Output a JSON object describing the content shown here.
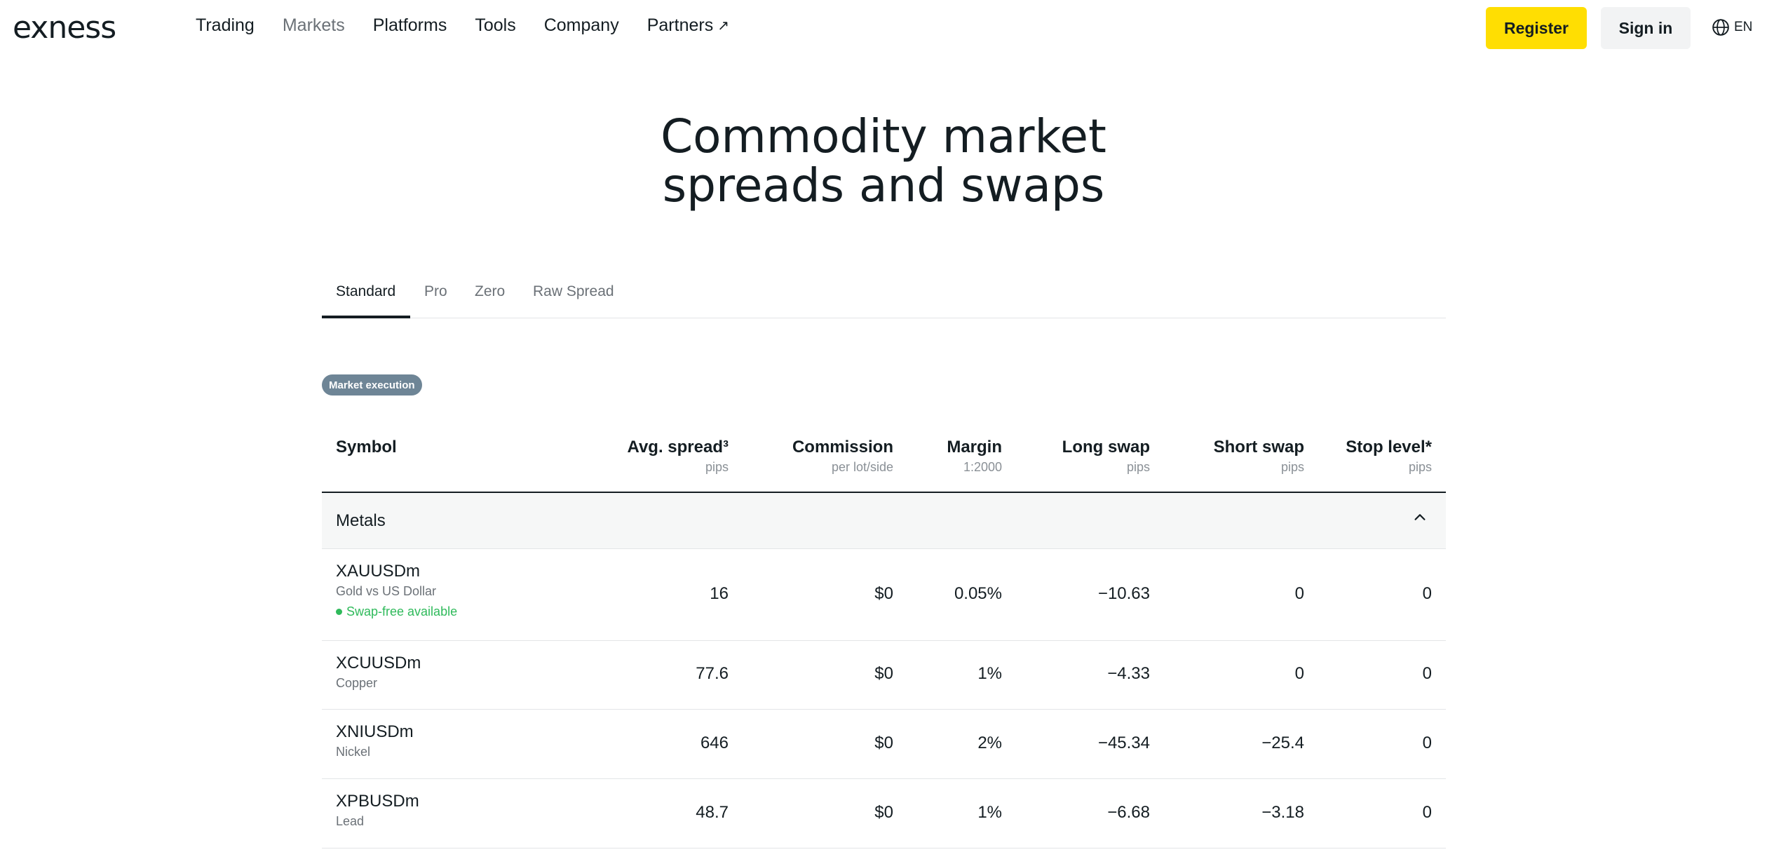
{
  "header": {
    "logo": "exness",
    "nav": [
      {
        "label": "Trading",
        "muted": false
      },
      {
        "label": "Markets",
        "muted": true
      },
      {
        "label": "Platforms",
        "muted": false
      },
      {
        "label": "Tools",
        "muted": false
      },
      {
        "label": "Company",
        "muted": false
      },
      {
        "label": "Partners",
        "muted": false,
        "external": true
      }
    ],
    "register_label": "Register",
    "signin_label": "Sign in",
    "language": "EN"
  },
  "page": {
    "title_line1": "Commodity market",
    "title_line2": "spreads and swaps"
  },
  "tabs": [
    {
      "label": "Standard",
      "active": true
    },
    {
      "label": "Pro",
      "active": false
    },
    {
      "label": "Zero",
      "active": false
    },
    {
      "label": "Raw Spread",
      "active": false
    }
  ],
  "badge": "Market execution",
  "table": {
    "columns": [
      {
        "title": "Symbol",
        "sub": ""
      },
      {
        "title": "Avg. spread³",
        "sub": "pips"
      },
      {
        "title": "Commission",
        "sub": "per lot/side"
      },
      {
        "title": "Margin",
        "sub": "1:2000"
      },
      {
        "title": "Long swap",
        "sub": "pips"
      },
      {
        "title": "Short swap",
        "sub": "pips"
      },
      {
        "title": "Stop level*",
        "sub": "pips"
      }
    ],
    "group": "Metals",
    "rows": [
      {
        "symbol": "XAUUSDm",
        "desc": "Gold vs US Dollar",
        "swap_free": "Swap-free available",
        "spread": "16",
        "commission": "$0",
        "margin": "0.05%",
        "long_swap": "−10.63",
        "short_swap": "0",
        "stop_level": "0"
      },
      {
        "symbol": "XCUUSDm",
        "desc": "Copper",
        "spread": "77.6",
        "commission": "$0",
        "margin": "1%",
        "long_swap": "−4.33",
        "short_swap": "0",
        "stop_level": "0"
      },
      {
        "symbol": "XNIUSDm",
        "desc": "Nickel",
        "spread": "646",
        "commission": "$0",
        "margin": "2%",
        "long_swap": "−45.34",
        "short_swap": "−25.4",
        "stop_level": "0"
      },
      {
        "symbol": "XPBUSDm",
        "desc": "Lead",
        "spread": "48.7",
        "commission": "$0",
        "margin": "1%",
        "long_swap": "−6.68",
        "short_swap": "−3.18",
        "stop_level": "0"
      }
    ]
  },
  "colors": {
    "brand_yellow": "#ffde02",
    "swap_free_green": "#2fba5b",
    "badge_bg": "#6e8596"
  }
}
